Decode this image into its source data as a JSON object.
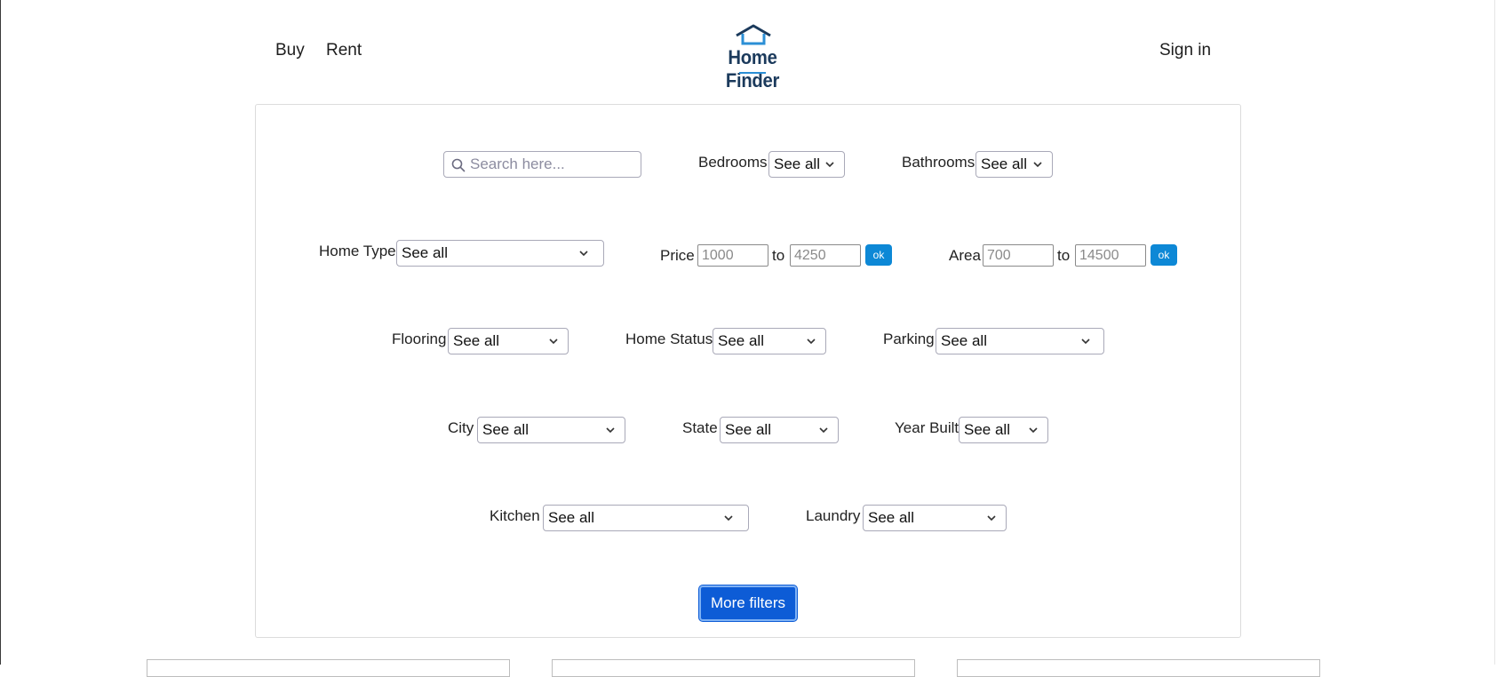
{
  "nav": {
    "buy": "Buy",
    "rent": "Rent",
    "sign_in": "Sign in"
  },
  "logo": {
    "text": "Home Finder",
    "icon": "house-roof-icon",
    "color": "#1b3a5c",
    "accent": "#2b8fd6"
  },
  "search": {
    "placeholder": "Search here...",
    "value": ""
  },
  "filters": {
    "bedrooms": {
      "label": "Bedrooms",
      "value": "See all"
    },
    "bathrooms": {
      "label": "Bathrooms",
      "value": "See all"
    },
    "home_type": {
      "label": "Home Type",
      "value": "See all"
    },
    "price": {
      "label": "Price",
      "min_placeholder": "1000",
      "to": "to",
      "max_placeholder": "4250",
      "ok": "ok"
    },
    "area": {
      "label": "Area",
      "min_placeholder": "700",
      "to": "to",
      "max_placeholder": "14500",
      "ok": "ok"
    },
    "flooring": {
      "label": "Flooring",
      "value": "See all"
    },
    "home_status": {
      "label": "Home Status",
      "value": "See all"
    },
    "parking": {
      "label": "Parking",
      "value": "See all"
    },
    "city": {
      "label": "City",
      "value": "See all"
    },
    "state": {
      "label": "State",
      "value": "See all"
    },
    "year_built": {
      "label": "Year Built",
      "value": "See all"
    },
    "kitchen": {
      "label": "Kitchen",
      "value": "See all"
    },
    "laundry": {
      "label": "Laundry",
      "value": "See all"
    }
  },
  "more_filters": "More filters",
  "colors": {
    "ok_button": "#0d88d6",
    "primary_button": "#0d5cd6"
  }
}
